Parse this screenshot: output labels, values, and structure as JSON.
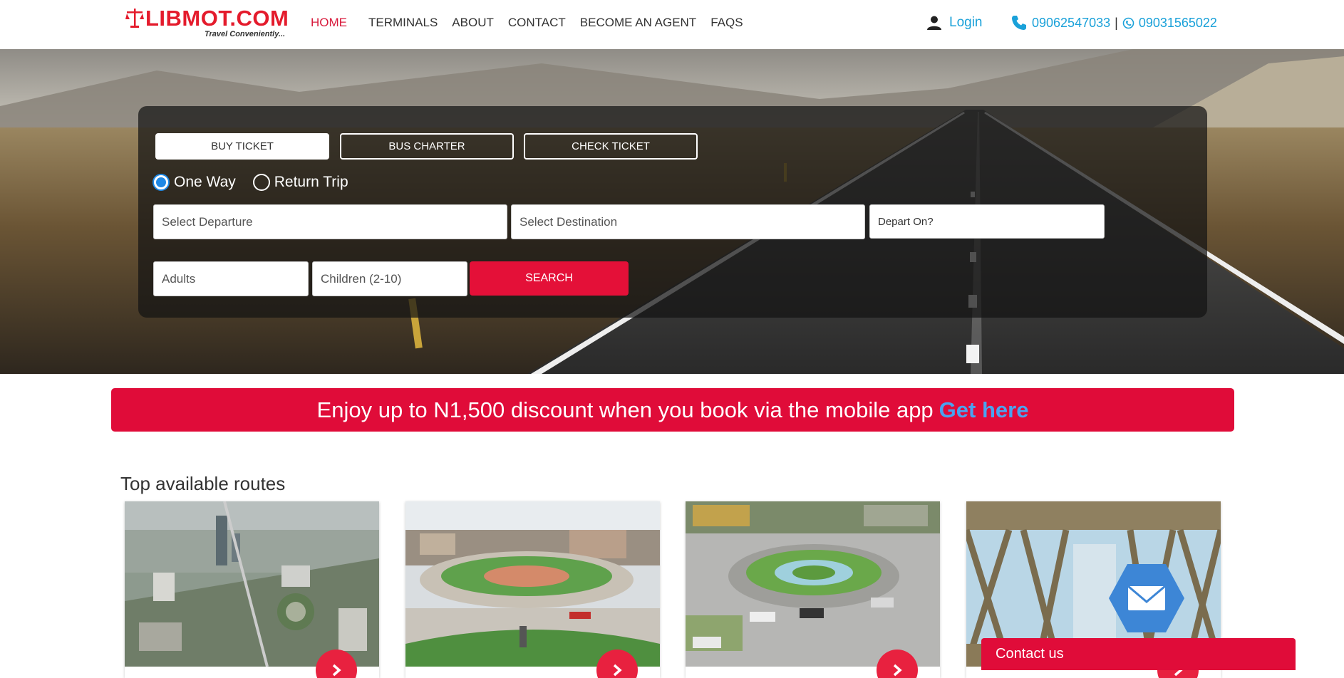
{
  "brand": {
    "name": "LIBMOT.COM",
    "tagline": "Travel Conveniently...",
    "accent": "#e41b2c"
  },
  "nav": {
    "items": [
      {
        "label": "HOME",
        "active": true
      },
      {
        "label": "TERMINALS"
      },
      {
        "label": "ABOUT"
      },
      {
        "label": "CONTACT"
      },
      {
        "label": "BECOME AN AGENT"
      },
      {
        "label": "FAQS"
      }
    ]
  },
  "header": {
    "login_label": "Login",
    "phone1": "09062547033",
    "separator": "|",
    "phone2": "09031565022",
    "link_color": "#1aa1d9"
  },
  "booking": {
    "tabs": [
      {
        "label": "BUY TICKET",
        "active": true
      },
      {
        "label": "BUS CHARTER"
      },
      {
        "label": "CHECK TICKET"
      }
    ],
    "trip_types": [
      {
        "label": "One Way",
        "selected": true
      },
      {
        "label": "Return Trip",
        "selected": false
      }
    ],
    "departure_placeholder": "Select Departure",
    "destination_placeholder": "Select Destination",
    "date_placeholder": "Depart On?",
    "adults_placeholder": "Adults",
    "children_placeholder": "Children (2-10)",
    "search_label": "SEARCH",
    "search_color": "#e41038"
  },
  "promo": {
    "text": "Enjoy up to N1,500 discount when you book via the mobile app",
    "link": "Get here"
  },
  "routes": {
    "title": "Top available routes",
    "cards": [
      {
        "image": "city-aerial-skyline"
      },
      {
        "image": "roundabout-gardens"
      },
      {
        "image": "roundabout-traffic"
      },
      {
        "image": "steel-bridge"
      }
    ]
  },
  "widgets": {
    "mail_icon": "envelope-icon",
    "contact_label": "Contact us"
  }
}
